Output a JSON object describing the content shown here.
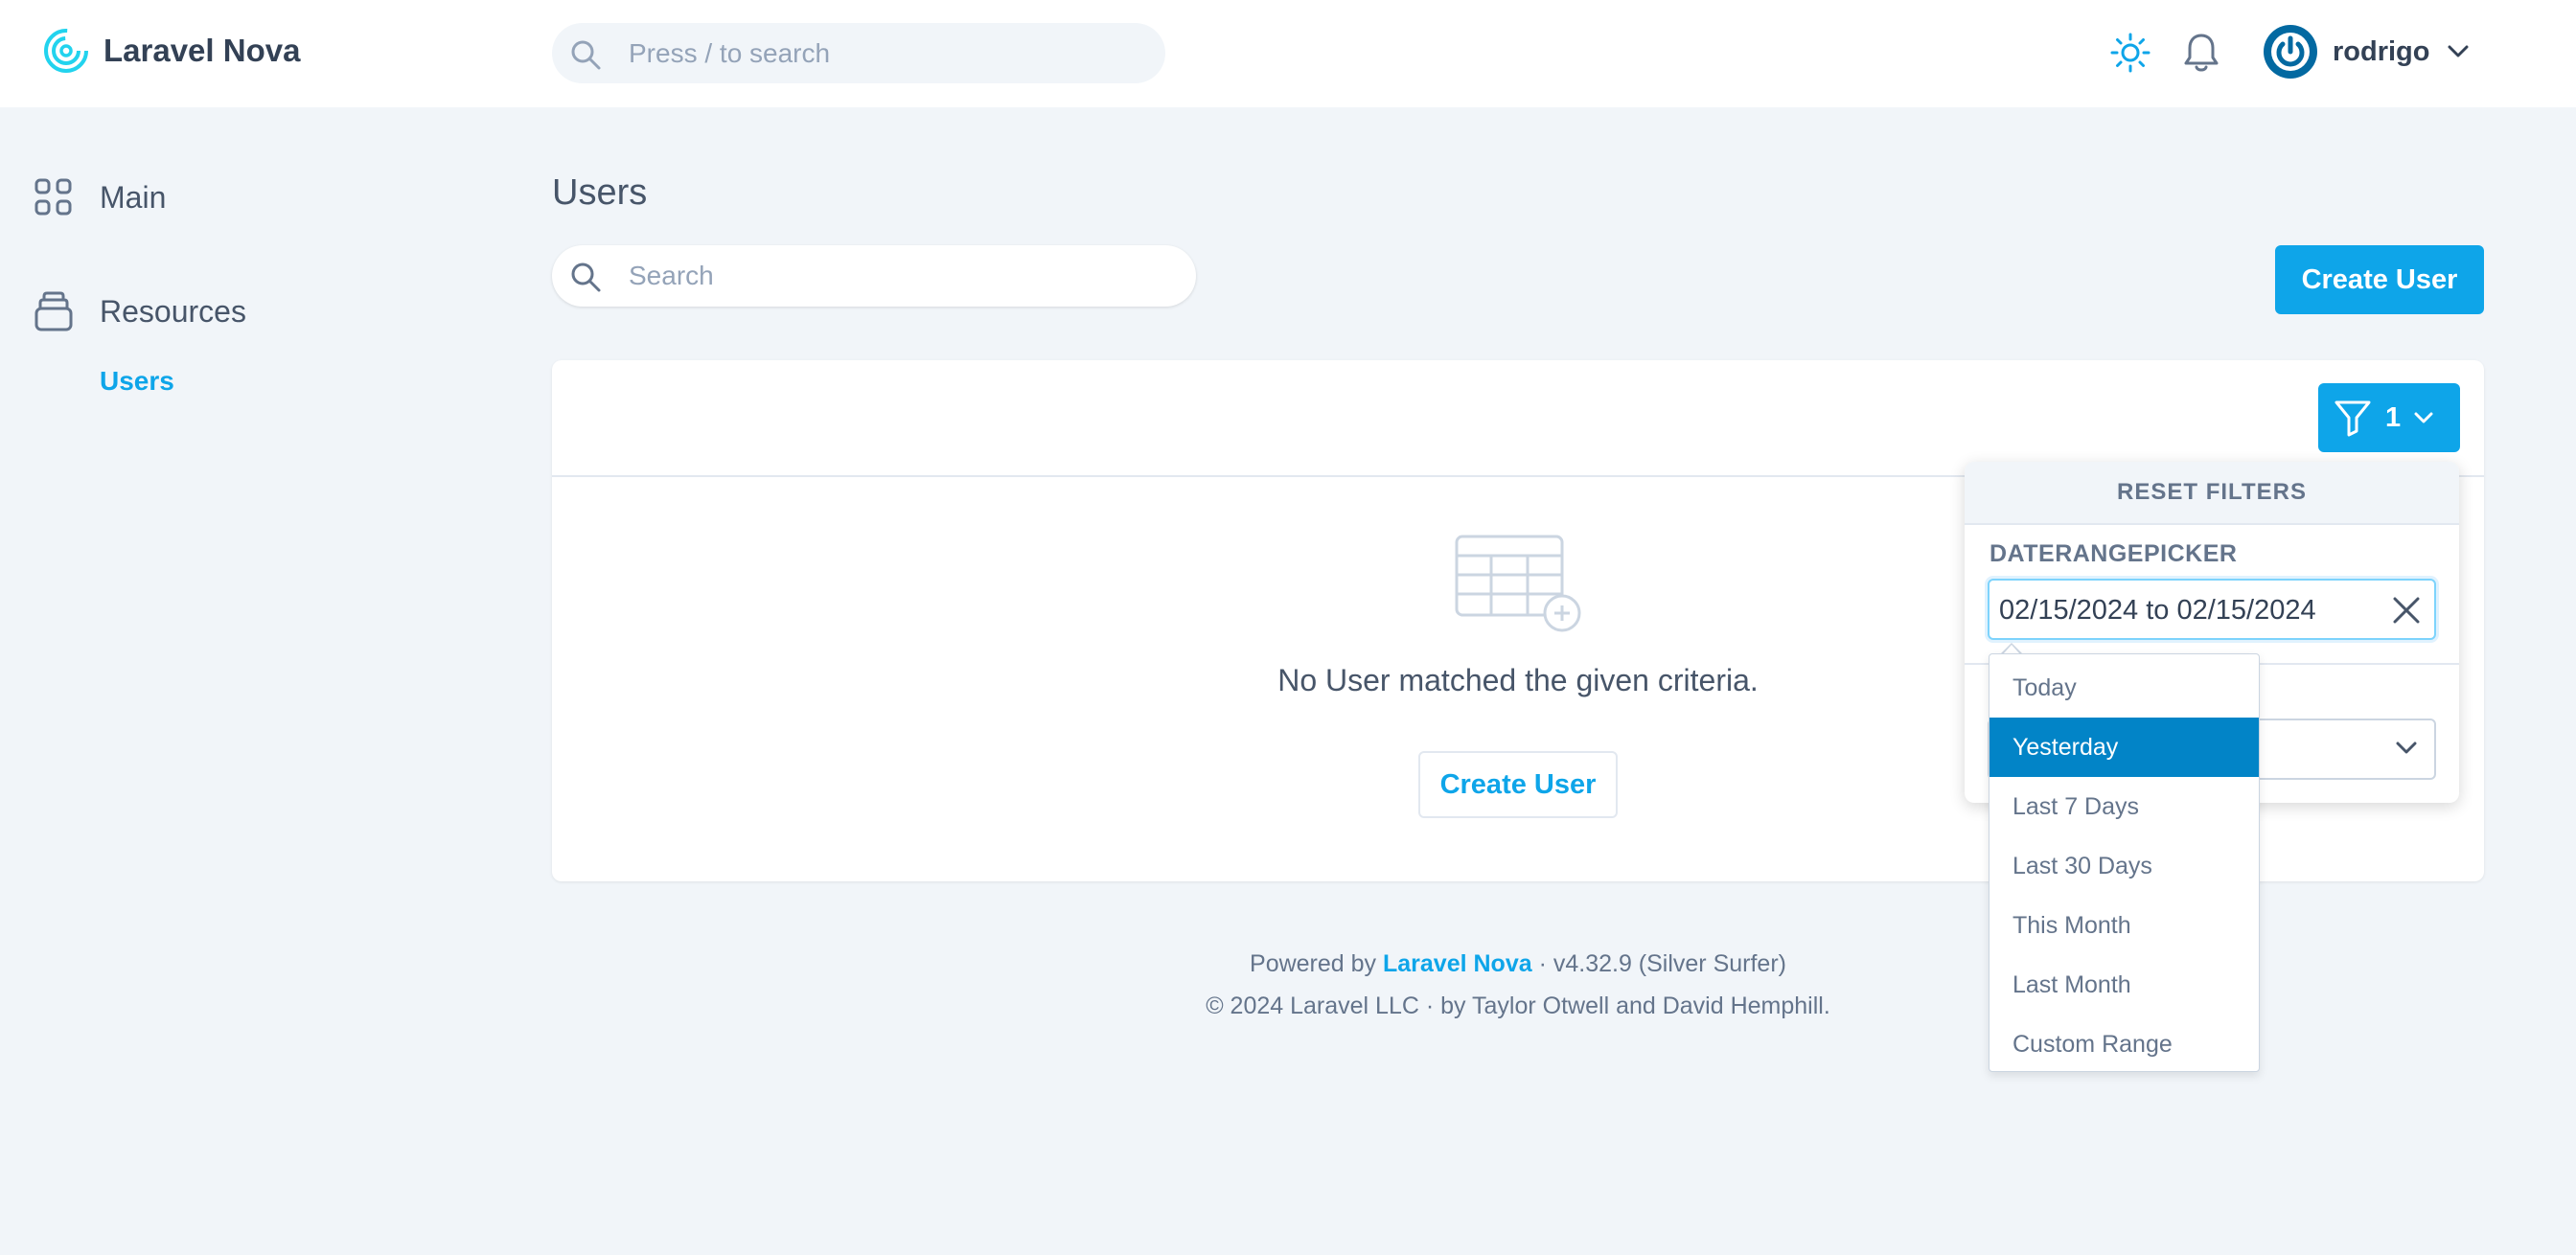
{
  "app": {
    "name": "Laravel Nova"
  },
  "header": {
    "search_placeholder": "Press / to search",
    "user_name": "rodrigo",
    "icons": {
      "theme": "sun-icon",
      "notifications": "bell-icon",
      "user_menu": "chevron-down-icon"
    }
  },
  "sidebar": {
    "main_label": "Main",
    "resources_label": "Resources",
    "users_label": "Users"
  },
  "main": {
    "page_title": "Users",
    "search_placeholder": "Search",
    "create_button": "Create User",
    "filter_count": "1",
    "empty_message": "No User matched the given criteria.",
    "empty_create_button": "Create User"
  },
  "filters": {
    "reset_label": "RESET FILTERS",
    "daterange_label": "DATERANGEPICKER",
    "daterange_value": "02/15/2024 to 02/15/2024",
    "ranges": [
      {
        "label": "Today",
        "active": false
      },
      {
        "label": "Yesterday",
        "active": true
      },
      {
        "label": "Last 7 Days",
        "active": false
      },
      {
        "label": "Last 30 Days",
        "active": false
      },
      {
        "label": "This Month",
        "active": false
      },
      {
        "label": "Last Month",
        "active": false
      },
      {
        "label": "Custom Range",
        "active": false
      }
    ]
  },
  "footer": {
    "powered_prefix": "Powered by ",
    "powered_link": "Laravel Nova",
    "powered_suffix": " · v4.32.9 (Silver Surfer)",
    "copyright": "© 2024 Laravel LLC · by Taylor Otwell and David Hemphill."
  },
  "colors": {
    "accent": "#0ea5e9",
    "active_range": "#0284c7",
    "background": "#f1f5f9"
  }
}
